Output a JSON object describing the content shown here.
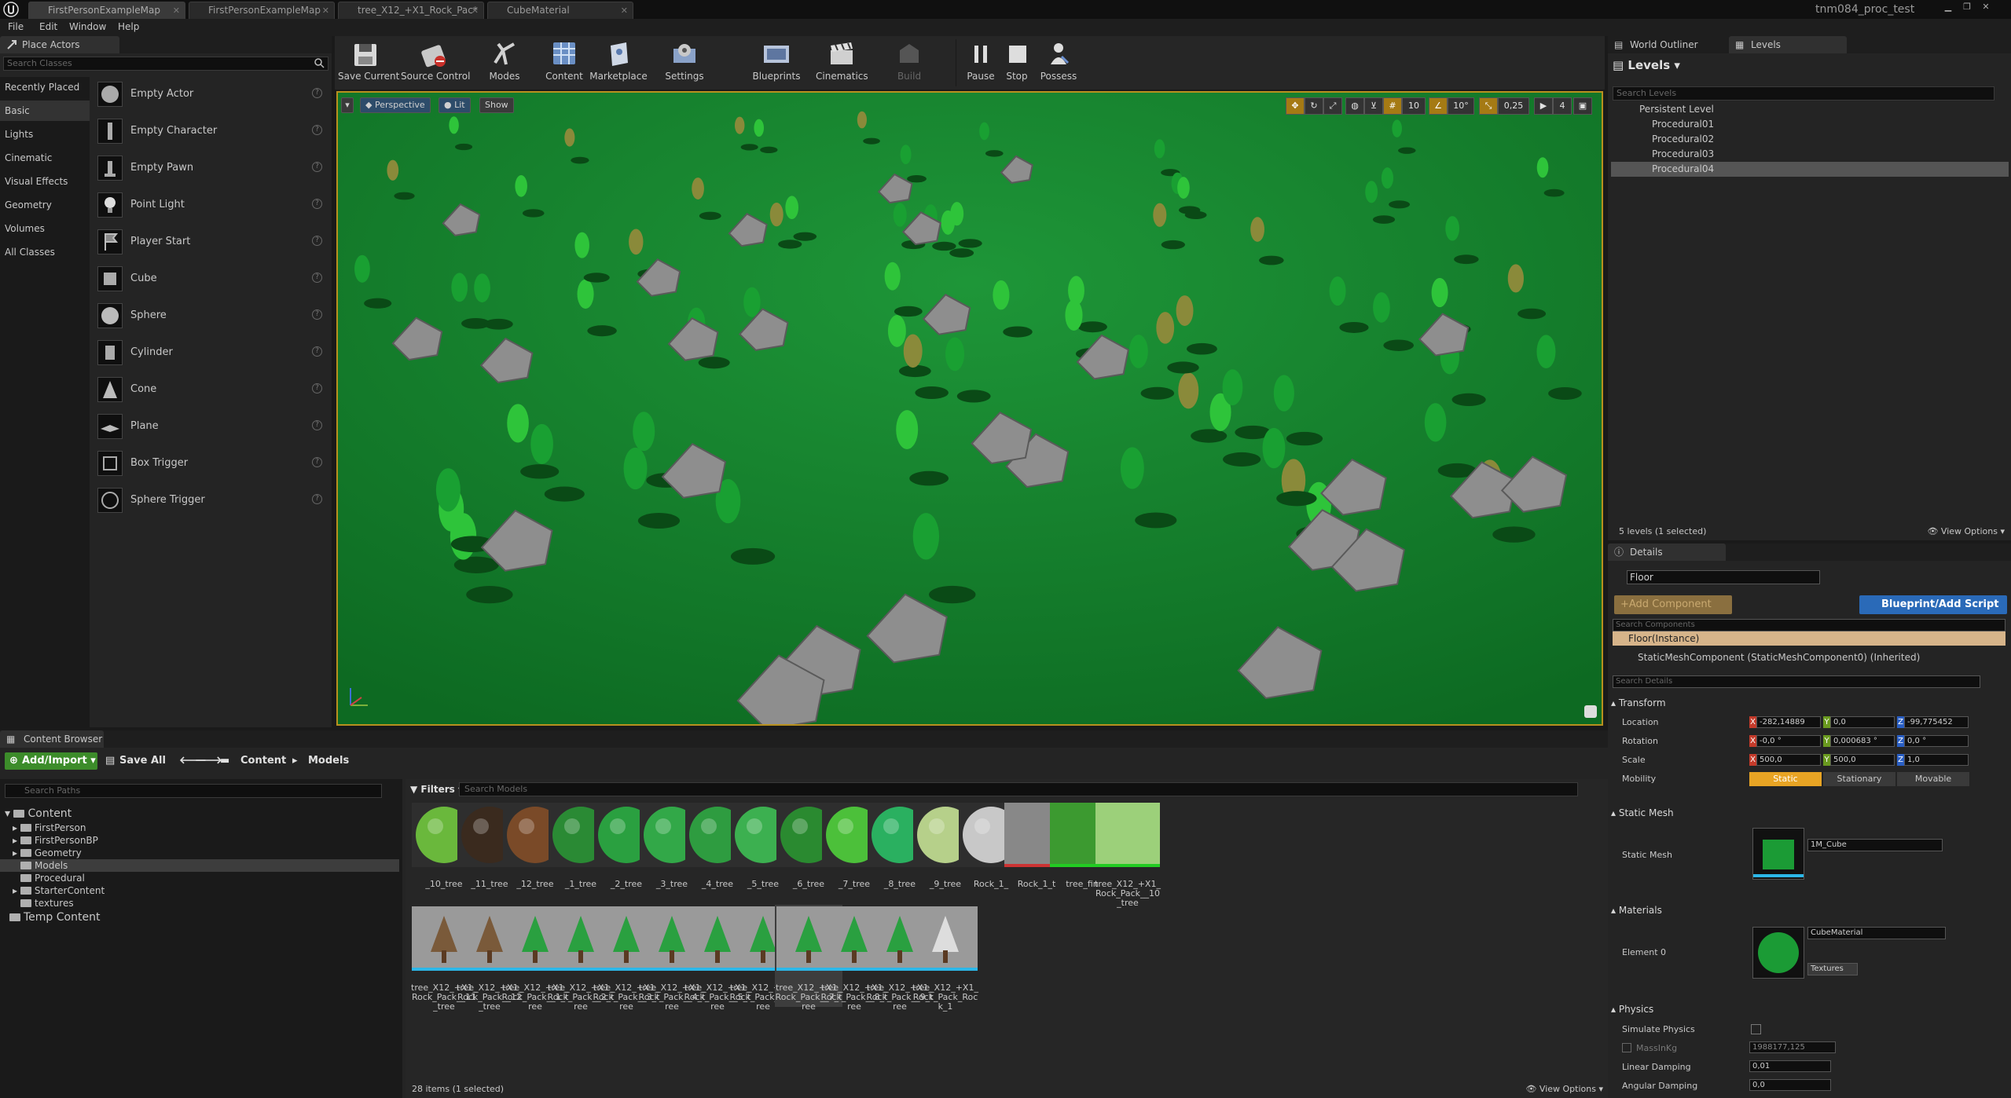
{
  "tabs": [
    {
      "label": "FirstPersonExampleMap",
      "active": true
    },
    {
      "label": "FirstPersonExampleMap",
      "active": false
    },
    {
      "label": "tree_X12_+X1_Rock_Pac*",
      "active": false
    },
    {
      "label": "CubeMaterial",
      "active": false
    }
  ],
  "project_name": "tnm084_proc_test",
  "menu": [
    "File",
    "Edit",
    "Window",
    "Help"
  ],
  "place_actors": {
    "title": "Place Actors",
    "search_placeholder": "Search Classes",
    "categories": [
      "Recently Placed",
      "Basic",
      "Lights",
      "Cinematic",
      "Visual Effects",
      "Geometry",
      "Volumes",
      "All Classes"
    ],
    "selected_category": "Basic",
    "actors": [
      "Empty Actor",
      "Empty Character",
      "Empty Pawn",
      "Point Light",
      "Player Start",
      "Cube",
      "Sphere",
      "Cylinder",
      "Cone",
      "Plane",
      "Box Trigger",
      "Sphere Trigger"
    ]
  },
  "toolbar": [
    {
      "label": "Save Current",
      "icon": "save-icon"
    },
    {
      "label": "Source Control",
      "icon": "source-control-icon"
    },
    {
      "label": "Modes",
      "icon": "modes-icon"
    },
    {
      "label": "Content",
      "icon": "content-icon"
    },
    {
      "label": "Marketplace",
      "icon": "marketplace-icon"
    },
    {
      "label": "Settings",
      "icon": "settings-icon"
    },
    {
      "label": "Blueprints",
      "icon": "blueprints-icon"
    },
    {
      "label": "Cinematics",
      "icon": "cinematics-icon"
    },
    {
      "label": "Build",
      "icon": "build-icon"
    },
    {
      "label": "Pause",
      "icon": "pause-icon"
    },
    {
      "label": "Stop",
      "icon": "stop-icon"
    },
    {
      "label": "Possess",
      "icon": "possess-icon"
    }
  ],
  "viewport": {
    "perspective": "Perspective",
    "lit": "Lit",
    "show": "Show",
    "grid_snap": "10",
    "rotation_snap": "10°",
    "scale_snap": "0,25",
    "camera_speed": "4"
  },
  "outliner": {
    "tab_world": "World Outliner",
    "tab_levels": "Levels",
    "levels_title": "Levels",
    "search_placeholder": "Search Levels",
    "levels": [
      {
        "name": "Persistent Level",
        "selected": false
      },
      {
        "name": "Procedural01",
        "selected": false
      },
      {
        "name": "Procedural02",
        "selected": false
      },
      {
        "name": "Procedural03",
        "selected": false
      },
      {
        "name": "Procedural04",
        "selected": true
      }
    ],
    "count_text": "5 levels (1 selected)",
    "view_options": "View Options"
  },
  "details": {
    "tab": "Details",
    "object_name": "Floor",
    "add_component": "+Add Component",
    "blueprint_button": "Blueprint/Add Script",
    "search_components": "Search Components",
    "instance": "Floor(Instance)",
    "component": "StaticMeshComponent (StaticMeshComponent0) (Inherited)",
    "search_details": "Search Details",
    "transform": {
      "title": "Transform",
      "location_label": "Location",
      "rotation_label": "Rotation",
      "scale_label": "Scale",
      "mobility_label": "Mobility",
      "location": [
        "-282,14889",
        "0,0",
        "-99,775452"
      ],
      "rotation": [
        "-0,0 °",
        "0,000683 °",
        "0,0 °"
      ],
      "scale": [
        "500,0",
        "500,0",
        "1,0"
      ],
      "mobility": [
        "Static",
        "Stationary",
        "Movable"
      ]
    },
    "static_mesh": {
      "title": "Static Mesh",
      "label": "Static Mesh",
      "value": "1M_Cube"
    },
    "materials": {
      "title": "Materials",
      "label": "Element 0",
      "value": "CubeMaterial",
      "textures": "Textures"
    },
    "physics": {
      "title": "Physics",
      "simulate": "Simulate Physics",
      "mass_label": "MassInKg",
      "mass_value": "1988177,125",
      "linear_label": "Linear Damping",
      "linear_value": "0,01",
      "angular_label": "Angular Damping",
      "angular_value": "0,0"
    }
  },
  "content_browser": {
    "title": "Content Browser",
    "add_import": "Add/Import",
    "save_all": "Save All",
    "breadcrumb": [
      "Content",
      "Models"
    ],
    "search_paths": "Search Paths",
    "tree": [
      {
        "label": "Content",
        "level": 0
      },
      {
        "label": "FirstPerson",
        "level": 1
      },
      {
        "label": "FirstPersonBP",
        "level": 1
      },
      {
        "label": "Geometry",
        "level": 1
      },
      {
        "label": "Models",
        "level": 1,
        "selected": true
      },
      {
        "label": "Procedural",
        "level": 1
      },
      {
        "label": "StarterContent",
        "level": 1
      },
      {
        "label": "textures",
        "level": 1
      },
      {
        "label": "Temp Content",
        "level": 0
      }
    ],
    "filters": "Filters",
    "search_models": "Search Models",
    "assets_row1": [
      "_10_tree",
      "_11_tree",
      "_12_tree",
      "_1_tree",
      "_2_tree",
      "_3_tree",
      "_4_tree",
      "_5_tree",
      "_6_tree",
      "_7_tree",
      "_8_tree",
      "_9_tree",
      "Rock_1_",
      "Rock_1_t",
      "tree_fin",
      "tree_X12_+X1_Rock_Pack__10_tree"
    ],
    "assets_row2": [
      "tree_X12_+X1_Rock_Pack__11_tree",
      "tree_X12_+X1_Rock_Pack__12_tree",
      "tree_X12_+X1_Rock_Pack__1_tree",
      "tree_X12_+X1_Rock_Pack__2_tree",
      "tree_X12_+X1_Rock_Pack__3_tree",
      "tree_X12_+X1_Rock_Pack__4_tree",
      "tree_X12_+X1_Rock_Pack__5_tree",
      "tree_X12_+X1_Rock_Pack__6_tree",
      "tree_X12_+X1_Rock_Pack__7_tree",
      "tree_X12_+X1_Rock_Pack__8_tree",
      "tree_X12_+X1_Rock_Pack__9_tree",
      "tree_X12_+X1_Rock_Pack_Rock_1"
    ],
    "selected_asset": "tree_X12_+X1_Rock_Pack__7_tree",
    "item_count": "28 items (1 selected)",
    "view_options": "View Options"
  }
}
